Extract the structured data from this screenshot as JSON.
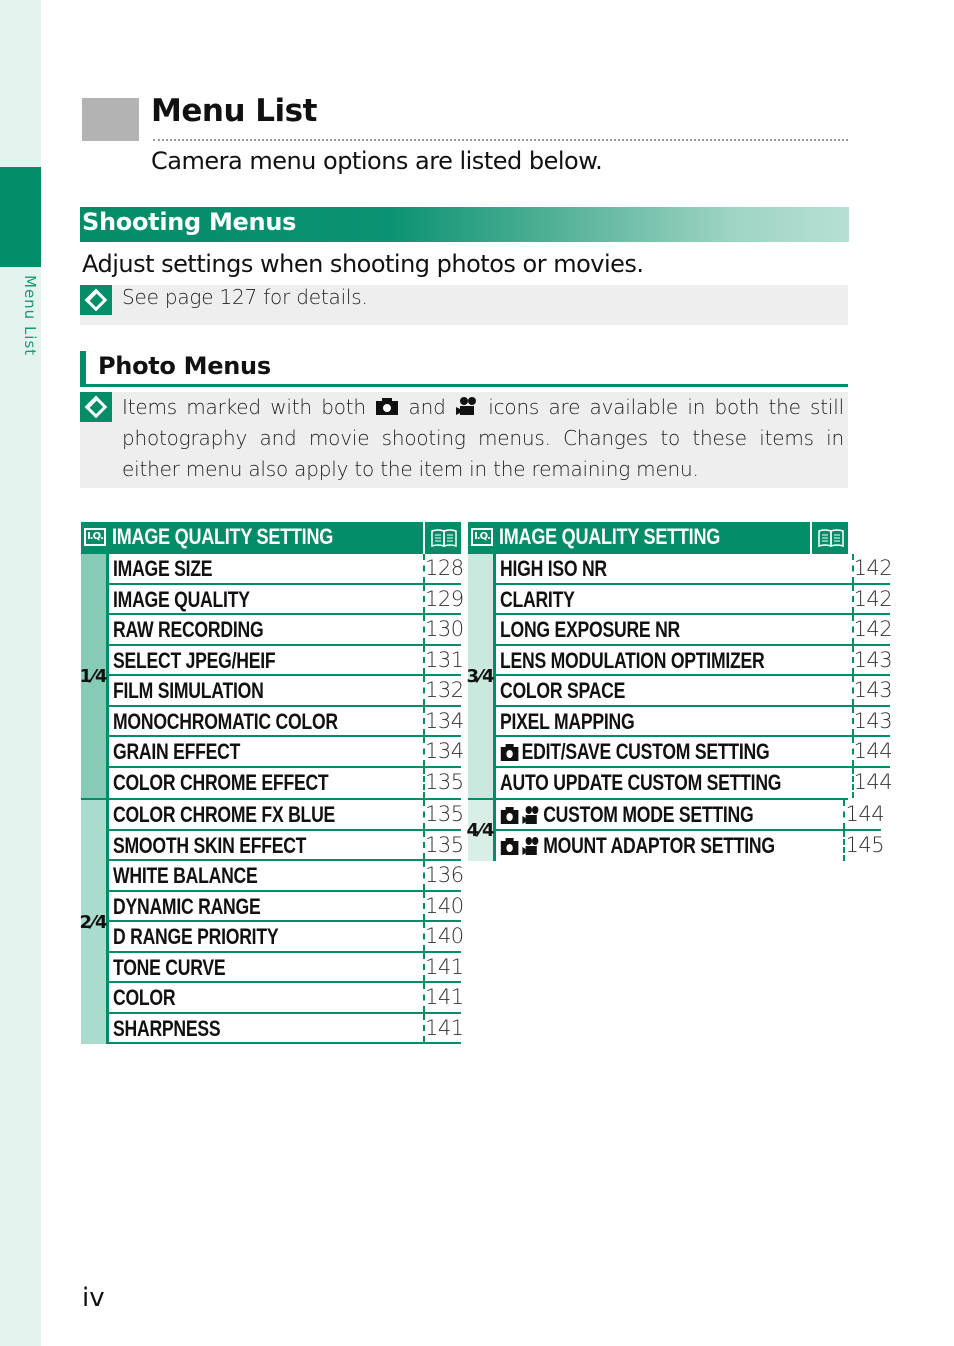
{
  "side_tab": {
    "label": "Menu List"
  },
  "header": {
    "title": "Menu List",
    "subtitle": "Camera menu options are listed below."
  },
  "section": {
    "title": "Shooting Menus",
    "lead": "Adjust settings when shooting photos or movies.",
    "note": "See page 127 for details."
  },
  "photo_menus": {
    "title": "Photo Menus",
    "note_part1": "Items marked with both",
    "note_part2": "and",
    "note_part3": "icons are available in both the still photography and movie shooting menus. Changes to these items in either menu also apply to the item in the remaining menu."
  },
  "colors": {
    "accent": "#038c68",
    "note_bg": "#eeeeee",
    "title_square": "#b3b3b3"
  },
  "tables": [
    {
      "header_icon": "I.Q.",
      "header_title": "IMAGE QUALITY SETTING",
      "header_page_icon": "book-icon",
      "groups": [
        {
          "label": "1⁄4",
          "rows": [
            {
              "name": "IMAGE SIZE",
              "page": "128"
            },
            {
              "name": "IMAGE QUALITY",
              "page": "129"
            },
            {
              "name": "RAW RECORDING",
              "page": "130"
            },
            {
              "name": "SELECT JPEG/HEIF",
              "page": "131"
            },
            {
              "name": "FILM SIMULATION",
              "page": "132"
            },
            {
              "name": "MONOCHROMATIC COLOR",
              "page": "134"
            },
            {
              "name": "GRAIN EFFECT",
              "page": "134"
            },
            {
              "name": "COLOR CHROME EFFECT",
              "page": "135"
            }
          ]
        },
        {
          "label": "2⁄4",
          "rows": [
            {
              "name": "COLOR CHROME FX BLUE",
              "page": "135"
            },
            {
              "name": "SMOOTH SKIN EFFECT",
              "page": "135"
            },
            {
              "name": "WHITE BALANCE",
              "page": "136"
            },
            {
              "name": "DYNAMIC RANGE",
              "page": "140"
            },
            {
              "name": "D RANGE PRIORITY",
              "page": "140"
            },
            {
              "name": "TONE CURVE",
              "page": "141"
            },
            {
              "name": "COLOR",
              "page": "141"
            },
            {
              "name": "SHARPNESS",
              "page": "141"
            }
          ]
        }
      ]
    },
    {
      "header_icon": "I.Q.",
      "header_title": "IMAGE QUALITY SETTING",
      "header_page_icon": "book-icon",
      "groups": [
        {
          "label": "3⁄4",
          "rows": [
            {
              "name": "HIGH ISO NR",
              "page": "142"
            },
            {
              "name": "CLARITY",
              "page": "142"
            },
            {
              "name": "LONG EXPOSURE NR",
              "page": "142"
            },
            {
              "name": "LENS MODULATION OPTIMIZER",
              "page": "143"
            },
            {
              "name": "COLOR SPACE",
              "page": "143"
            },
            {
              "name": "PIXEL MAPPING",
              "page": "143"
            },
            {
              "name": "EDIT/SAVE CUSTOM SETTING",
              "page": "144",
              "icons": [
                "camera-icon"
              ]
            },
            {
              "name": "AUTO UPDATE CUSTOM SETTING",
              "page": "144"
            }
          ]
        },
        {
          "label": "4⁄4",
          "rows": [
            {
              "name": "CUSTOM MODE SETTING",
              "page": "144",
              "icons": [
                "camera-icon",
                "movie-camera-icon"
              ]
            },
            {
              "name": "MOUNT ADAPTOR SETTING",
              "page": "145",
              "icons": [
                "camera-icon",
                "movie-camera-icon"
              ]
            }
          ]
        }
      ]
    }
  ],
  "footer": {
    "page_number": "iv"
  }
}
